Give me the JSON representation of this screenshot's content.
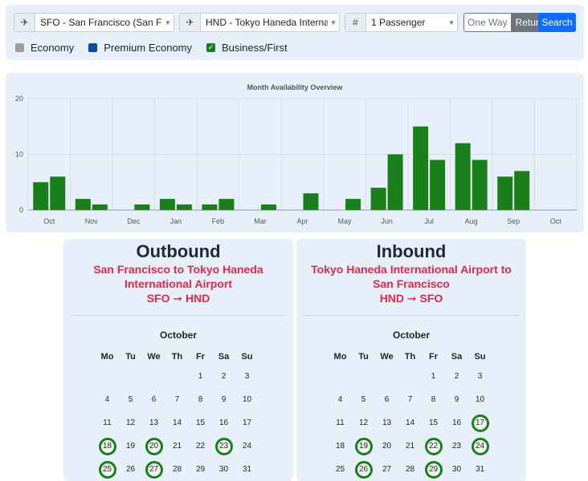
{
  "search": {
    "origin": "SFO - San Francisco (San Fra...",
    "destination": "HND - Tokyo Haneda Interna...",
    "passengers": "1 Passenger",
    "one_way": "One Way",
    "return": "Return",
    "search_button": "Search"
  },
  "cabin_legend": [
    {
      "label": "Economy",
      "color": "#9e9e9e"
    },
    {
      "label": "Premium Economy",
      "color": "#0b4f9c"
    },
    {
      "label": "Business/First",
      "color": "#1a7f1a",
      "checked": true
    }
  ],
  "chart_data": {
    "type": "bar",
    "title": "Month Availability Overview",
    "categories": [
      "Oct",
      "Nov",
      "Dec",
      "Jan",
      "Feb",
      "Mar",
      "Apr",
      "May",
      "Jun",
      "Jul",
      "Aug",
      "Sep",
      "Oct"
    ],
    "series": [
      {
        "values": [
          5,
          2,
          0,
          2,
          1,
          0,
          0,
          0,
          4,
          15,
          12,
          6,
          0
        ]
      },
      {
        "values": [
          6,
          1,
          1,
          1,
          2,
          1,
          3,
          2,
          10,
          9,
          9,
          7,
          0
        ]
      }
    ],
    "ylim": [
      0,
      20
    ],
    "yticks": [
      0,
      10,
      20
    ],
    "color": "#1a7f1a",
    "grid": true
  },
  "outbound": {
    "title": "Outbound",
    "route_line1": "San Francisco to Tokyo Haneda",
    "route_line2": "International Airport",
    "codes": "SFO ➞ HND",
    "month": "October",
    "weekdays": [
      "Mo",
      "Tu",
      "We",
      "Th",
      "Fr",
      "Sa",
      "Su"
    ],
    "start_offset": 4,
    "days": 31,
    "available": [
      18,
      20,
      23,
      25,
      27
    ]
  },
  "inbound": {
    "title": "Inbound",
    "route_line1": "Tokyo Haneda International Airport to",
    "route_line2": "San Francisco",
    "codes": "HND ➞ SFO",
    "month": "October",
    "weekdays": [
      "Mo",
      "Tu",
      "We",
      "Th",
      "Fr",
      "Sa",
      "Su"
    ],
    "start_offset": 4,
    "days": 31,
    "available": [
      17,
      19,
      22,
      24,
      26,
      29
    ]
  }
}
